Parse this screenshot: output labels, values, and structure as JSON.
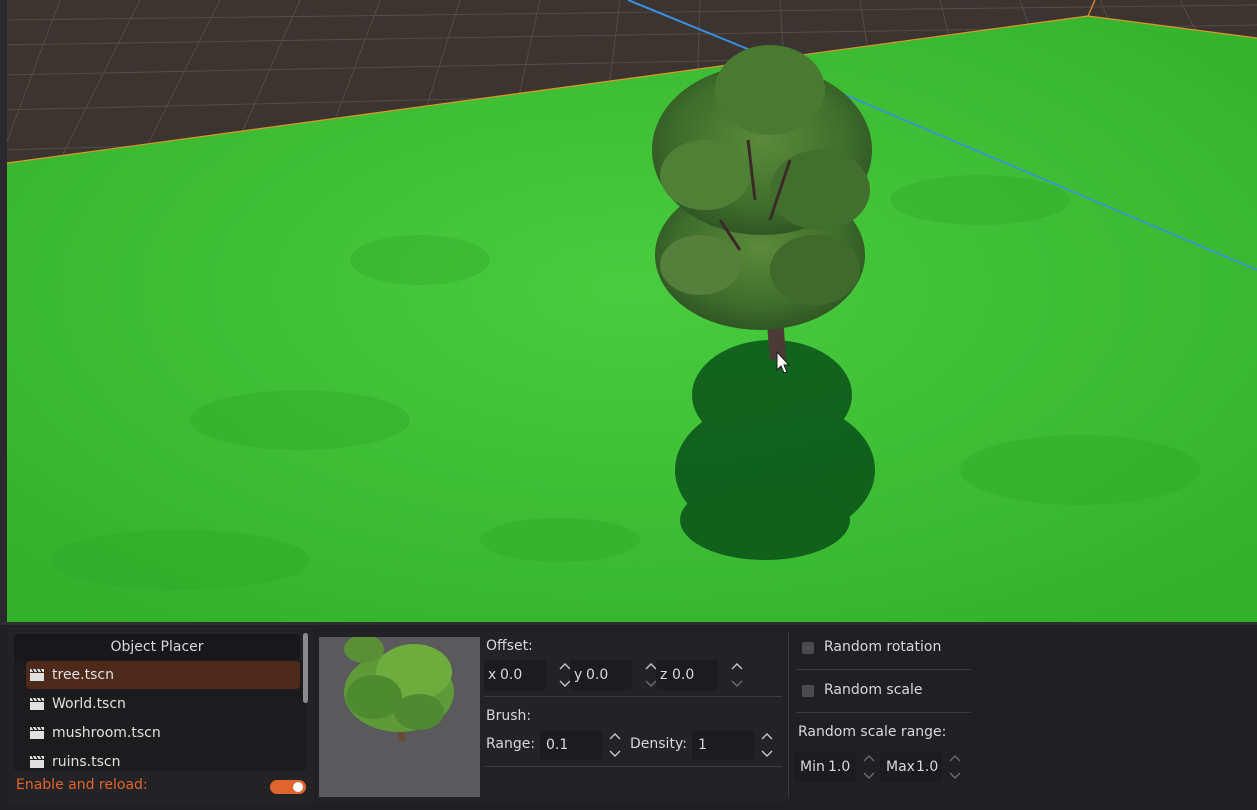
{
  "plugin": {
    "title": "Object Placer",
    "files": [
      {
        "label": "tree.tscn",
        "selected": true
      },
      {
        "label": "World.tscn",
        "selected": false
      },
      {
        "label": "mushroom.tscn",
        "selected": false
      },
      {
        "label": "ruins.tscn",
        "selected": false
      }
    ],
    "enable_label": "Enable and reload:",
    "enable_on": true
  },
  "offset": {
    "heading": "Offset:",
    "x": {
      "prefix": "x",
      "value": "0.0"
    },
    "y": {
      "prefix": "y",
      "value": "0.0"
    },
    "z": {
      "prefix": "z",
      "value": "0.0"
    }
  },
  "brush": {
    "heading": "Brush:",
    "range_label": "Range:",
    "range_value": "0.1",
    "density_label": "Density:",
    "density_value": "1"
  },
  "random": {
    "rotation_label": "Random rotation",
    "rotation_checked": false,
    "scale_label": "Random scale",
    "scale_checked": false,
    "range_heading": "Random scale range:",
    "min": {
      "prefix": "Min",
      "value": "1.0"
    },
    "max": {
      "prefix": "Max",
      "value": "1.0"
    }
  },
  "colors": {
    "accent": "#e0652a",
    "selected_row": "#4e2a1b",
    "ground_green": "#3ec336"
  }
}
